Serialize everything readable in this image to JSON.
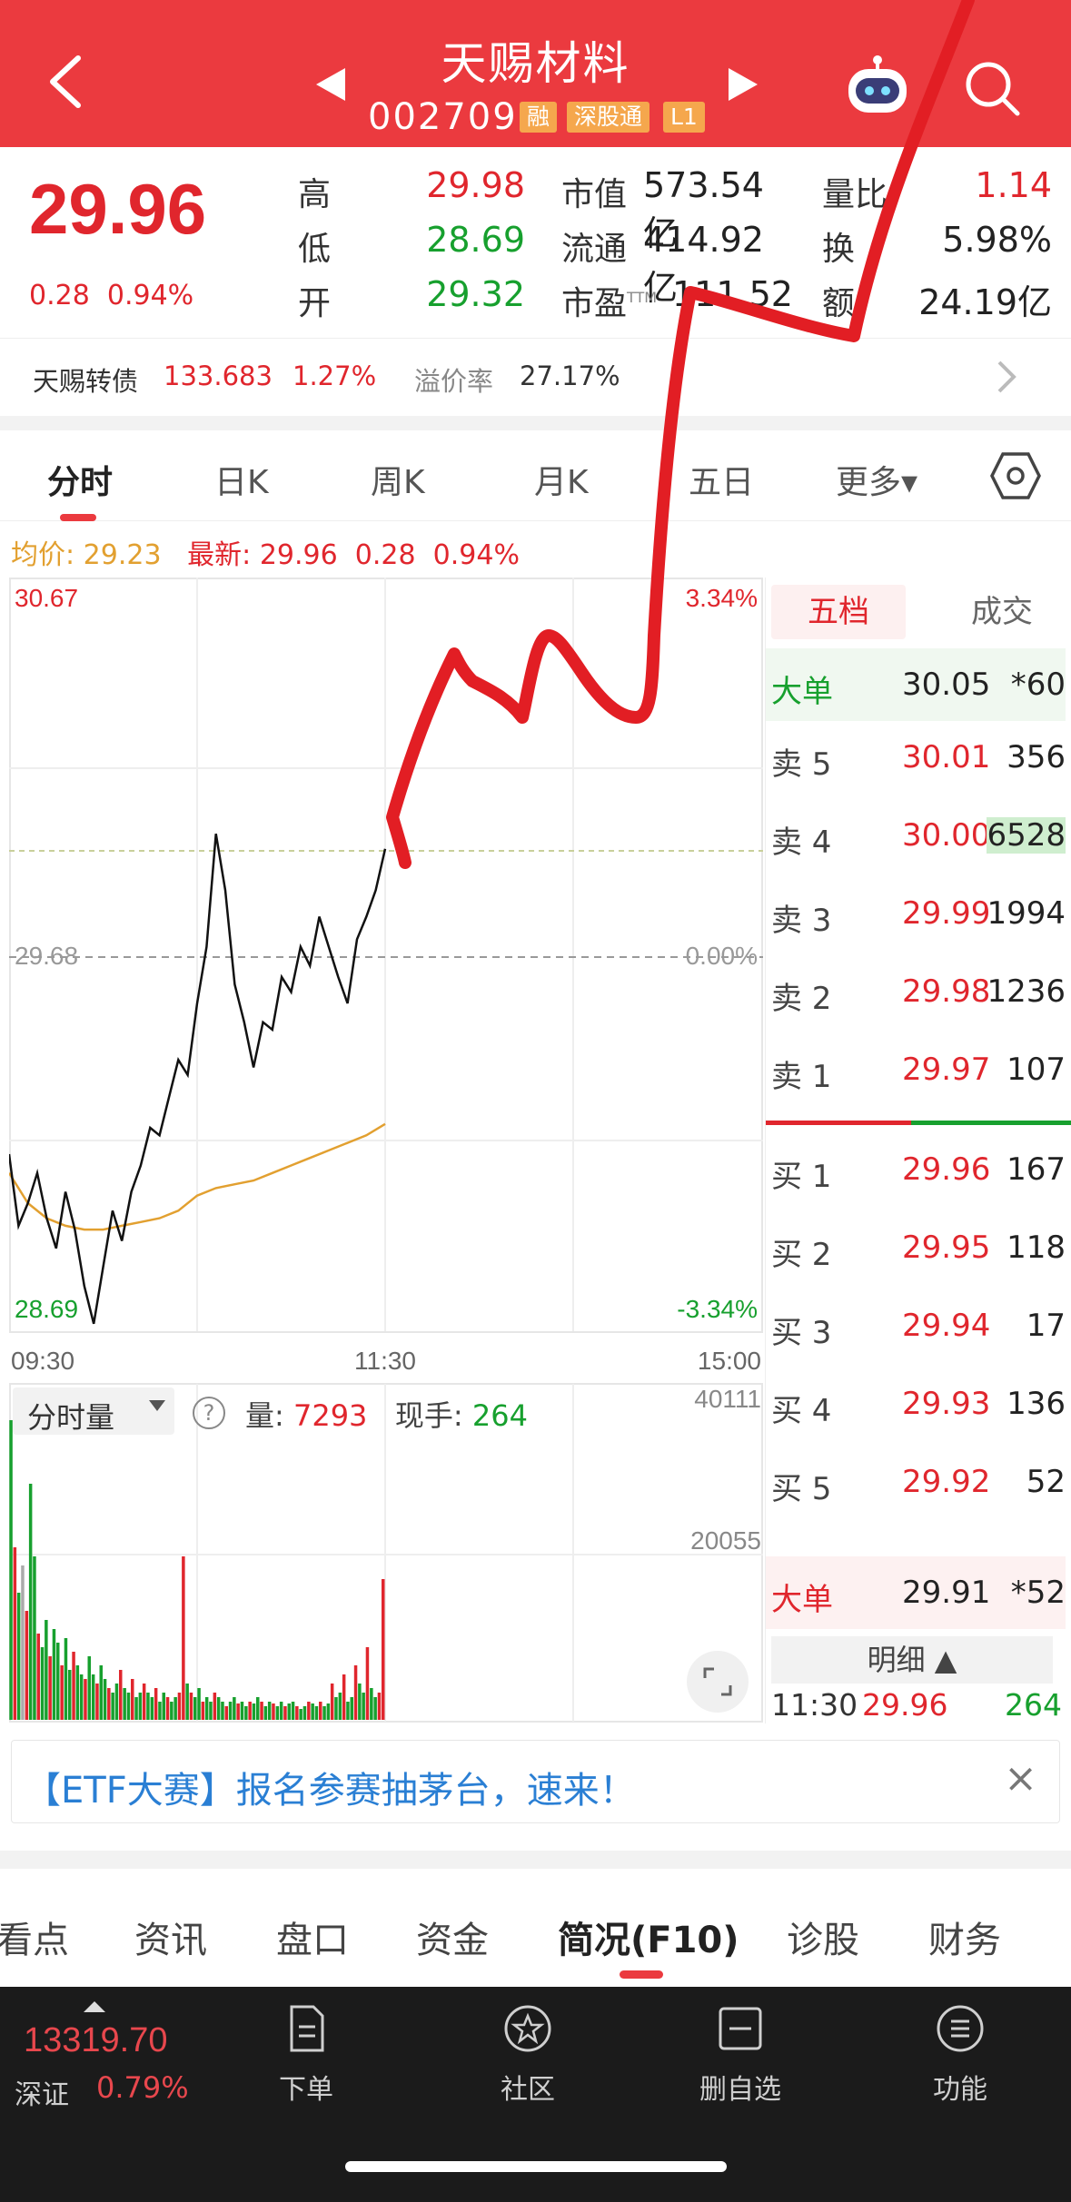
{
  "header": {
    "title": "天赐材料",
    "code": "002709",
    "tags": [
      "融",
      "深股通",
      "L1"
    ]
  },
  "quote": {
    "price": "29.96",
    "change": "0.28",
    "change_pct": "0.94%",
    "high_label": "高",
    "high": "29.98",
    "low_label": "低",
    "low": "28.69",
    "open_label": "开",
    "open": "29.32",
    "mktcap_label": "市值",
    "mktcap": "573.54亿",
    "float_label": "流通",
    "float": "414.92亿",
    "pe_label": "市盈",
    "pe_sup": "TTM",
    "pe": "111.52",
    "volratio_label": "量比",
    "volratio": "1.14",
    "turnover_label": "换",
    "turnover": "5.98%",
    "amount_label": "额",
    "amount": "24.19亿"
  },
  "bond": {
    "name": "天赐转债",
    "price": "133.683",
    "pct": "1.27%",
    "premium_label": "溢价率",
    "premium": "27.17%"
  },
  "ktabs": [
    "分时",
    "日K",
    "周K",
    "月K",
    "五日",
    "更多▾"
  ],
  "infoline": {
    "avg_label": "均价:",
    "avg": "29.23",
    "latest_label": "最新:",
    "latest": "29.96",
    "chg": "0.28",
    "pct": "0.94%"
  },
  "chart_labels": {
    "max_price": "30.67",
    "mid_price": "29.68",
    "min_price": "28.69",
    "max_pct": "3.34%",
    "mid_pct": "0.00%",
    "min_pct": "-3.34%",
    "t_start": "09:30",
    "t_mid": "11:30",
    "t_end": "15:00",
    "vol_selector": "分时量",
    "vol_label": "量:",
    "vol_value": "7293",
    "hand_label": "现手:",
    "hand_value": "264",
    "vol_max": "40111",
    "vol_mid": "20055"
  },
  "book": {
    "tabs": [
      "五档",
      "成交"
    ],
    "big_sell": {
      "label": "大单",
      "price": "30.05",
      "vol": "*60"
    },
    "asks": [
      {
        "label": "卖 5",
        "price": "30.01",
        "vol": "356"
      },
      {
        "label": "卖 4",
        "price": "30.00",
        "vol": "6528"
      },
      {
        "label": "卖 3",
        "price": "29.99",
        "vol": "1994"
      },
      {
        "label": "卖 2",
        "price": "29.98",
        "vol": "1236"
      },
      {
        "label": "卖 1",
        "price": "29.97",
        "vol": "107"
      }
    ],
    "bids": [
      {
        "label": "买 1",
        "price": "29.96",
        "vol": "167"
      },
      {
        "label": "买 2",
        "price": "29.95",
        "vol": "118"
      },
      {
        "label": "买 3",
        "price": "29.94",
        "vol": "17"
      },
      {
        "label": "买 4",
        "price": "29.93",
        "vol": "136"
      },
      {
        "label": "买 5",
        "price": "29.92",
        "vol": "52"
      }
    ],
    "big_buy": {
      "label": "大单",
      "price": "29.91",
      "vol": "*52"
    },
    "detail_label": "明细 ▲",
    "trade": {
      "time": "11:30",
      "price": "29.96",
      "vol": "264"
    }
  },
  "banner": {
    "text": "【ETF大赛】报名参赛抽茅台，速来！",
    "close": "×"
  },
  "info_tabs": [
    "看点",
    "资讯",
    "盘口",
    "资金",
    "简况(F10)",
    "诊股",
    "财务"
  ],
  "bottom": {
    "index_value": "13319.70",
    "index_name": "深证",
    "index_pct": "0.79%",
    "items": [
      "下单",
      "社区",
      "删自选",
      "功能"
    ]
  },
  "colors": {
    "brand_red": "#eb3a3f",
    "up_red": "#e0262d",
    "down_green": "#17a02e",
    "avg_gold": "#e2a030"
  },
  "chart_data": {
    "type": "line",
    "price_axis": {
      "min": 28.69,
      "mid": 29.68,
      "max": 30.67
    },
    "x_ticks": [
      "09:30",
      "11:30",
      "15:00"
    ],
    "series": [
      {
        "name": "最新",
        "values": [
          29.15,
          28.96,
          29.02,
          29.1,
          28.98,
          28.9,
          29.05,
          28.95,
          28.8,
          28.7,
          28.85,
          29.0,
          28.92,
          29.05,
          29.12,
          29.22,
          29.2,
          29.3,
          29.4,
          29.36,
          29.55,
          29.7,
          30.0,
          29.85,
          29.6,
          29.5,
          29.38,
          29.5,
          29.48,
          29.62,
          29.58,
          29.7,
          29.65,
          29.78,
          29.7,
          29.62,
          29.55,
          29.72,
          29.78,
          29.85,
          29.96
        ]
      },
      {
        "name": "均价",
        "values": [
          29.1,
          29.02,
          28.98,
          28.96,
          28.95,
          28.95,
          28.96,
          28.97,
          28.98,
          29.0,
          29.04,
          29.06,
          29.07,
          29.08,
          29.1,
          29.12,
          29.14,
          29.16,
          29.18,
          29.2,
          29.23
        ]
      }
    ],
    "volume_axis": {
      "max": 40111,
      "mid": 20055
    }
  }
}
